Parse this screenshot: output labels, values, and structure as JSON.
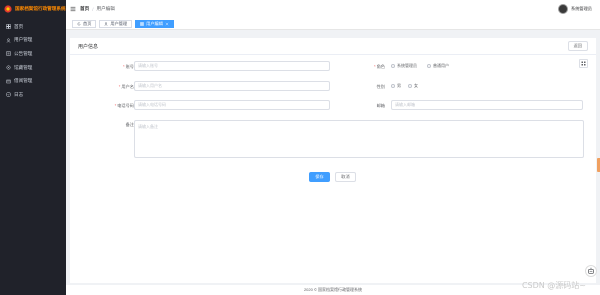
{
  "sidebar": {
    "brand": "国家档案馆行政管理系统",
    "items": [
      {
        "label": "首页",
        "icon": "dashboard-icon"
      },
      {
        "label": "用户管理",
        "icon": "user-icon"
      },
      {
        "label": "公告管理",
        "icon": "notice-icon"
      },
      {
        "label": "馆藏管理",
        "icon": "archive-icon"
      },
      {
        "label": "借阅管理",
        "icon": "borrow-icon"
      },
      {
        "label": "日志",
        "icon": "log-icon"
      }
    ]
  },
  "topbar": {
    "breadcrumb_home": "首页",
    "breadcrumb_sep": "/",
    "breadcrumb_current": "用户编辑",
    "username": "系统管理员"
  },
  "tags": [
    {
      "label": "首页",
      "active": false
    },
    {
      "label": "用户管理",
      "active": false
    },
    {
      "label": "用户编辑",
      "active": true
    }
  ],
  "card": {
    "title": "用户信息",
    "back_label": "返回"
  },
  "form": {
    "account": {
      "label": "账号",
      "placeholder": "请输入账号"
    },
    "role": {
      "label": "角色",
      "options": [
        "系统管理员",
        "普通用户"
      ]
    },
    "username": {
      "label": "用户名",
      "placeholder": "请输入用户名"
    },
    "gender": {
      "label": "性别",
      "options": [
        "男",
        "女"
      ]
    },
    "phone": {
      "label": "电话号码",
      "placeholder": "请输入电话号码"
    },
    "email": {
      "label": "邮箱",
      "placeholder": "请输入邮箱"
    },
    "remark": {
      "label": "备注",
      "placeholder": "请输入备注"
    },
    "save_label": "保存",
    "cancel_label": "取消"
  },
  "footer": {
    "text": "2020 © 国家档案馆行政管理系统"
  },
  "watermark": "CSDN @源码站~",
  "colors": {
    "sidebar_bg": "#20222a",
    "primary": "#409eff",
    "brand_orange": "#ff8a00",
    "required": "#f56c6c"
  }
}
